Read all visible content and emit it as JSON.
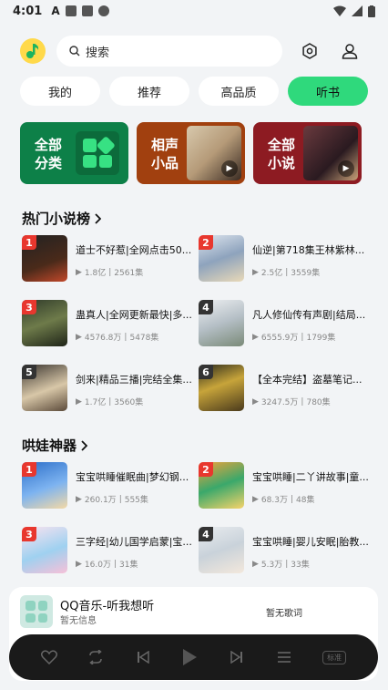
{
  "status": {
    "time": "4:01"
  },
  "search": {
    "placeholder": "搜索"
  },
  "tabs": [
    {
      "label": "我的"
    },
    {
      "label": "推荐"
    },
    {
      "label": "高品质"
    },
    {
      "label": "听书",
      "active": true
    }
  ],
  "categories": [
    {
      "label": "全部分类"
    },
    {
      "label": "相声小品"
    },
    {
      "label": "全部小说"
    }
  ],
  "sections": {
    "hot_novels": {
      "title": "热门小说榜",
      "items": [
        {
          "rank": "1",
          "title": "道士不好惹|全网点击50...",
          "plays": "1.8亿",
          "episodes": "2561集"
        },
        {
          "rank": "2",
          "title": "仙逆|第718集王林紫林...",
          "plays": "2.5亿",
          "episodes": "3559集"
        },
        {
          "rank": "3",
          "title": "蛊真人|全网更新最快|多...",
          "plays": "4576.8万",
          "episodes": "5478集"
        },
        {
          "rank": "4",
          "title": "凡人修仙传有声剧|结局...",
          "plays": "6555.9万",
          "episodes": "1799集"
        },
        {
          "rank": "5",
          "title": "剑来|精品三播|完结全集...",
          "plays": "1.7亿",
          "episodes": "3560集"
        },
        {
          "rank": "6",
          "title": "【全本完结】盗墓笔记...",
          "plays": "3247.5万",
          "episodes": "780集"
        }
      ]
    },
    "kids": {
      "title": "哄娃神器",
      "items": [
        {
          "rank": "1",
          "title": "宝宝哄睡催眠曲|梦幻钢...",
          "plays": "260.1万",
          "episodes": "555集"
        },
        {
          "rank": "2",
          "title": "宝宝哄睡|二丫讲故事|童...",
          "plays": "68.3万",
          "episodes": "48集"
        },
        {
          "rank": "3",
          "title": "三字经|幼儿国学启蒙|宝...",
          "plays": "16.0万",
          "episodes": "31集"
        },
        {
          "rank": "4",
          "title": "宝宝哄睡|婴儿安眠|胎教...",
          "plays": "5.3万",
          "episodes": "33集"
        }
      ]
    }
  },
  "player": {
    "title": "QQ音乐-听我想听",
    "subtitle": "暂无信息",
    "lyric": "暂无歌词",
    "quality": "标准"
  },
  "colors": {
    "accent": "#2fd97c",
    "rank_red": "#e8372e"
  }
}
